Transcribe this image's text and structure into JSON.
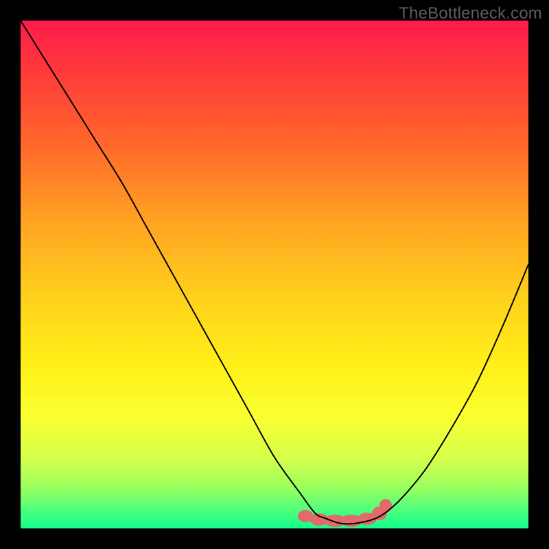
{
  "attribution": "TheBottleneck.com",
  "chart_data": {
    "type": "line",
    "title": "",
    "xlabel": "",
    "ylabel": "",
    "xlim": [
      0,
      100
    ],
    "ylim": [
      0,
      100
    ],
    "grid": false,
    "legend": false,
    "series": [
      {
        "name": "bottleneck-curve",
        "x": [
          0,
          5,
          10,
          15,
          20,
          25,
          30,
          35,
          40,
          45,
          50,
          55,
          58,
          60,
          63,
          66,
          70,
          73,
          76,
          80,
          85,
          90,
          95,
          100
        ],
        "values": [
          100,
          92,
          84,
          76,
          68,
          59,
          50,
          41,
          32,
          23,
          14,
          7,
          3,
          2,
          1,
          1,
          2,
          4,
          7,
          12,
          20,
          29,
          40,
          52
        ]
      }
    ],
    "highlight": {
      "x_range": [
        55,
        73
      ],
      "y_value": 1
    },
    "background_gradient_stops": [
      {
        "pos": 0.0,
        "color": "#ff1a4d"
      },
      {
        "pos": 0.1,
        "color": "#ff3a3a"
      },
      {
        "pos": 0.25,
        "color": "#ff6a2a"
      },
      {
        "pos": 0.4,
        "color": "#ffa522"
      },
      {
        "pos": 0.55,
        "color": "#ffd21c"
      },
      {
        "pos": 0.68,
        "color": "#fff018"
      },
      {
        "pos": 0.78,
        "color": "#faff30"
      },
      {
        "pos": 0.86,
        "color": "#d6ff4a"
      },
      {
        "pos": 0.92,
        "color": "#9aff5e"
      },
      {
        "pos": 0.96,
        "color": "#54ff7a"
      },
      {
        "pos": 1.0,
        "color": "#12ff8c"
      }
    ]
  }
}
